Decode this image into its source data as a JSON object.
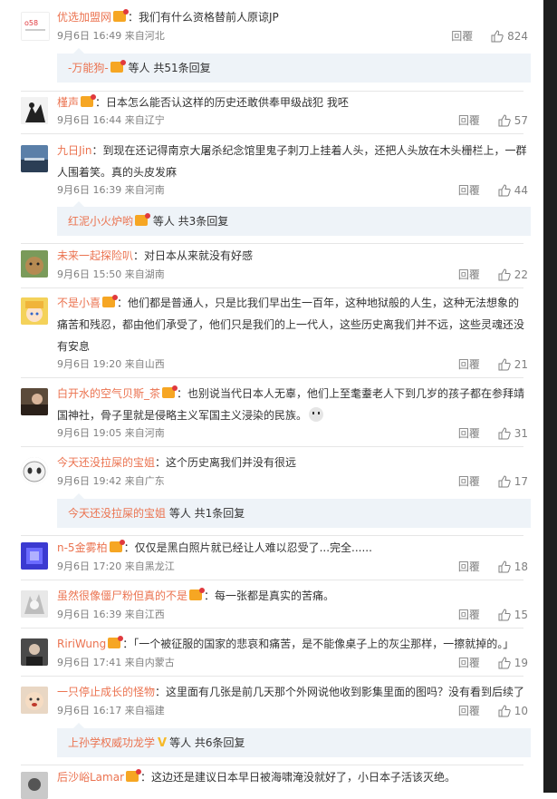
{
  "comments": [
    {
      "user": "优选加盟网",
      "badge": "vip",
      "text": "：我们有什么资格替前人原谅JP",
      "time": "9月6日 16:49 来自河北",
      "reply": "回覆",
      "likes": "824",
      "sub": {
        "user": "-万能狗-",
        "badge": "vip",
        "rest": "等人 共51条回复"
      }
    },
    {
      "user": "槿声",
      "badge": "vip",
      "text": "：日本怎么能否认这样的历史还敢供奉甲级战犯 我呸",
      "time": "9月6日 16:44 来自辽宁",
      "reply": "回覆",
      "likes": "57"
    },
    {
      "user": "九日Jin",
      "badge": "",
      "text": "：到现在还记得南京大屠杀纪念馆里鬼子刺刀上挂着人头，还把人头放在木头栅栏上，一群人围着笑。真的头皮发麻",
      "time": "9月6日 16:39 来自河南",
      "reply": "回覆",
      "likes": "44",
      "sub": {
        "user": "红泥小火炉哟",
        "badge": "vip",
        "rest": "等人 共3条回复"
      }
    },
    {
      "user": "未来一起探险叭",
      "badge": "",
      "text": "：对日本从来就没有好感",
      "time": "9月6日 15:50 来自湖南",
      "reply": "回覆",
      "likes": "22"
    },
    {
      "user": "不是小喜",
      "badge": "vip",
      "text": "：他们都是普通人，只是比我们早出生一百年，这种地狱般的人生，这种无法想象的痛苦和残忍，都由他们承受了，他们只是我们的上一代人，这些历史离我们并不远，这些灵魂还没有安息",
      "time": "9月6日 19:20 来自山西",
      "reply": "回覆",
      "likes": "21"
    },
    {
      "user": "白开水的空气贝斯_茶",
      "badge": "vip",
      "text": "：也别说当代日本人无辜，他们上至耄耋老人下到几岁的孩子都在参拜靖国神社，骨子里就是侵略主义军国主义浸染的民族。",
      "time": "9月6日 19:05 来自河南",
      "reply": "回覆",
      "likes": "31"
    },
    {
      "user": "今天还没拉屎的宝姐",
      "badge": "",
      "text": "：这个历史离我们并没有很远",
      "time": "9月6日 19:42 来自广东",
      "reply": "回覆",
      "likes": "17",
      "sub": {
        "user": "今天还没拉屎的宝姐",
        "badge": "",
        "rest": "等人 共1条回复"
      }
    },
    {
      "user": "n-5金雾柏",
      "badge": "vip",
      "text": "：仅仅是黑白照片就已经让人难以忍受了...完全......",
      "time": "9月6日 17:20 来自黑龙江",
      "reply": "回覆",
      "likes": "18"
    },
    {
      "user": "虽然很像僵尸粉但真的不是",
      "badge": "vip",
      "text": "：每一张都是真实的苦痛。",
      "time": "9月6日 16:39 来自江西",
      "reply": "回覆",
      "likes": "15"
    },
    {
      "user": "RiriWung",
      "badge": "vip",
      "text": "：「一个被征服的国家的悲哀和痛苦，是不能像桌子上的灰尘那样，一擦就掉的。」",
      "time": "9月6日 17:41 来自内蒙古",
      "reply": "回覆",
      "likes": "19"
    },
    {
      "user": "一只停止成长的怪物",
      "badge": "",
      "text": "：这里面有几张是前几天那个外网说他收到影集里面的图吗？没有看到后续了",
      "time": "9月6日 16:17 来自福建",
      "reply": "回覆",
      "likes": "10",
      "sub": {
        "user": "上孙学权威功龙学",
        "badge": "v",
        "rest": "等人 共6条回复"
      }
    },
    {
      "user": "后沙峪Lamar",
      "badge": "vip",
      "text": "：这边还是建议日本早日被海啸淹没就好了，小日本子活该灭绝。",
      "time": "",
      "reply": "",
      "likes": ""
    }
  ],
  "colors": {
    "link": "#eb7350",
    "subbg": "#eef3f8",
    "meta": "#808080",
    "badge": "#f6a623"
  }
}
